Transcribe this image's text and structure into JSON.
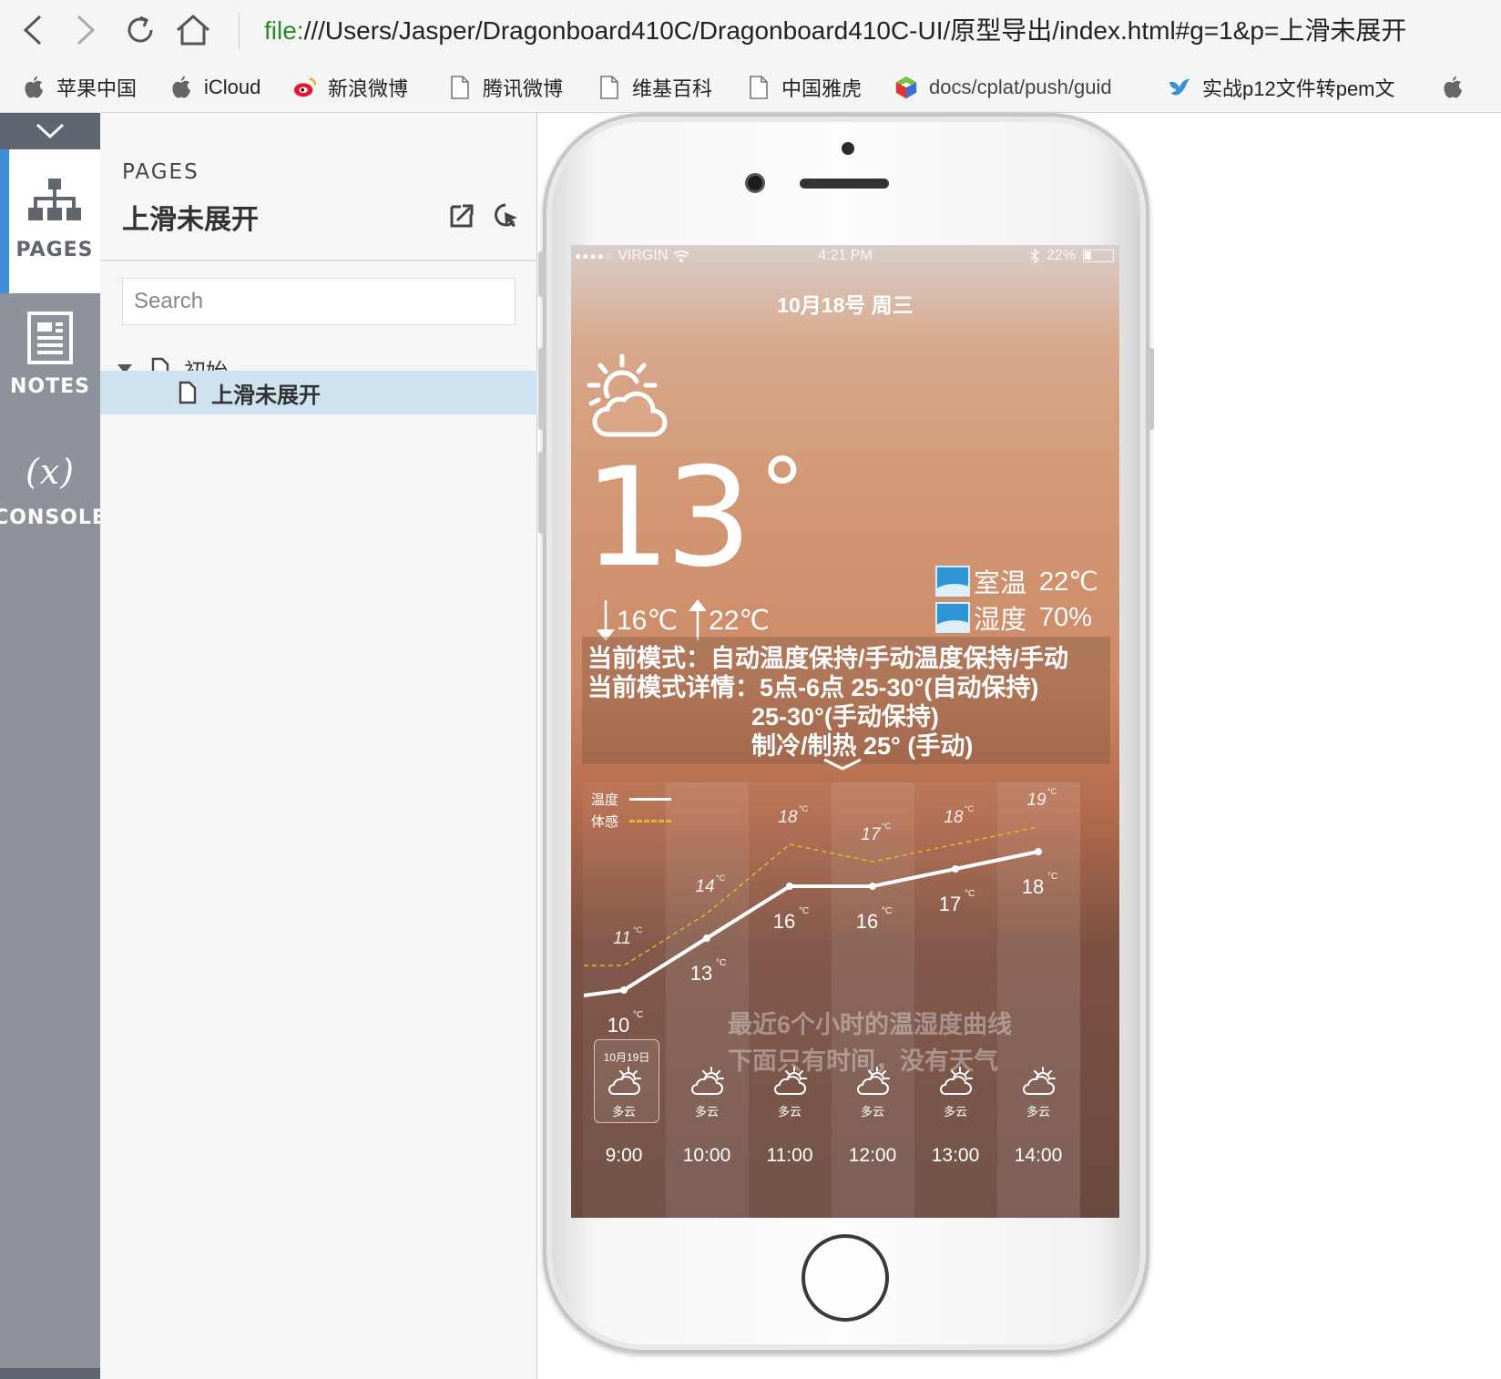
{
  "browser": {
    "address_scheme": "file:",
    "address_rest": "///Users/Jasper/Dragonboard410C/Dragonboard410C-UI/原型导出/index.html#g=1&p=上滑未展开"
  },
  "bookmarks": [
    {
      "label": "苹果中国",
      "icon": "apple-icon"
    },
    {
      "label": "iCloud",
      "icon": "apple-icon"
    },
    {
      "label": "新浪微博",
      "icon": "weibo-icon"
    },
    {
      "label": "腾讯微博",
      "icon": "page-icon"
    },
    {
      "label": "维基百科",
      "icon": "page-icon"
    },
    {
      "label": "中国雅虎",
      "icon": "page-icon"
    },
    {
      "label": "docs/cplat/push/guid",
      "icon": "cube-icon"
    },
    {
      "label": "实战p12文件转pem文",
      "icon": "bird-icon"
    }
  ],
  "rail": {
    "pages": "PAGES",
    "notes": "NOTES",
    "console_symbol": "(x)",
    "console": "CONSOLE"
  },
  "panel": {
    "heading": "PAGES",
    "title": "上滑未展开",
    "search_placeholder": "Search",
    "tree": [
      {
        "label": "初始",
        "level": 0,
        "expanded": true,
        "selected": false
      },
      {
        "label": "上滑未展开",
        "level": 1,
        "expanded": false,
        "selected": true
      }
    ]
  },
  "phone": {
    "status": {
      "carrier": "VIRGIN",
      "time": "4:21 PM",
      "battery": "22%"
    },
    "date": "10月18号 周三",
    "temperature": "13",
    "degree": "°",
    "low": "16℃",
    "high": "22℃",
    "indoor": [
      {
        "label": "室温",
        "value": "22℃"
      },
      {
        "label": "湿度",
        "value": "70%"
      }
    ],
    "mode_lines": [
      "当前模式：自动温度保持/手动温度保持/手动",
      "当前模式详情：5点-6点 25-30°(自动保持)",
      "25-30°(手动保持)",
      "制冷/制热 25° (手动)"
    ],
    "legend": {
      "temp": "温度",
      "feel": "体感"
    },
    "note_lines": [
      "最近6个小时的温湿度曲线",
      "下面只有时间，没有天气"
    ],
    "badge_date": "10月19日",
    "colors": {
      "accent": "#3b8fd6",
      "selected_row": "#cfe2ef",
      "feel_line": "#e8b530",
      "indoor_icon": "#2d95d6"
    }
  },
  "chart_data": {
    "type": "line",
    "categories": [
      "9:00",
      "10:00",
      "11:00",
      "12:00",
      "13:00",
      "14:00"
    ],
    "series": [
      {
        "name": "温度",
        "values": [
          10,
          13,
          16,
          16,
          17,
          18
        ],
        "unit": "°C"
      },
      {
        "name": "体感",
        "values": [
          11,
          14,
          18,
          17,
          18,
          19
        ],
        "unit": "°C"
      }
    ],
    "conditions": [
      "多云",
      "多云",
      "多云",
      "多云",
      "多云",
      "多云"
    ]
  }
}
